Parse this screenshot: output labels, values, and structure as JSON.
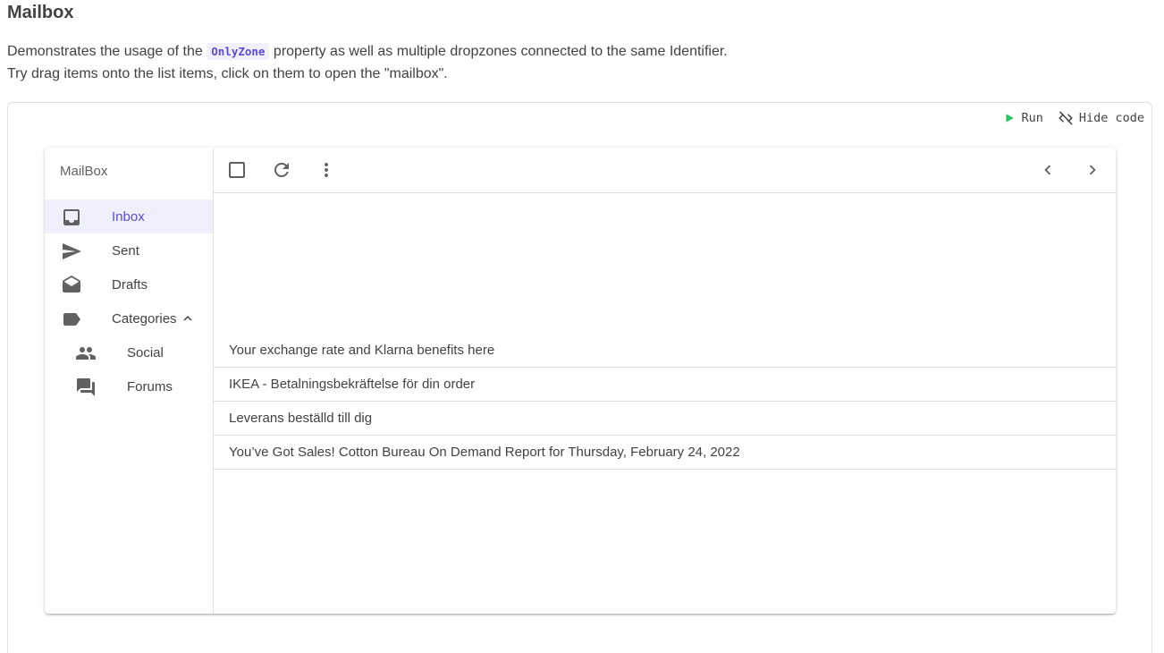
{
  "page": {
    "title": "Mailbox",
    "desc_before": "Demonstrates the usage of the ",
    "desc_code": "OnlyZone",
    "desc_after": " property as well as multiple dropzones connected to the same Identifier.",
    "desc_line2": "Try drag items onto the list items, click on them to open the \"mailbox\"."
  },
  "toolbar": {
    "run_label": "Run",
    "hide_code_label": "Hide code",
    "run_color": "#22c55e"
  },
  "mailbox": {
    "title": "MailBox",
    "accent": "#594ae2",
    "nav": [
      {
        "label": "Inbox",
        "icon": "inbox-icon"
      },
      {
        "label": "Sent",
        "icon": "send-icon"
      },
      {
        "label": "Drafts",
        "icon": "drafts-icon"
      },
      {
        "label": "Categories",
        "icon": "label-icon"
      },
      {
        "label": "Social",
        "icon": "people-icon"
      },
      {
        "label": "Forums",
        "icon": "forum-icon"
      }
    ],
    "mails": [
      "Your exchange rate and Klarna benefits here",
      "IKEA - Betalningsbekräftelse för din order",
      "Leverans beställd till dig",
      "You’ve Got Sales! Cotton Bureau On Demand Report for Thursday, February 24, 2022"
    ]
  }
}
